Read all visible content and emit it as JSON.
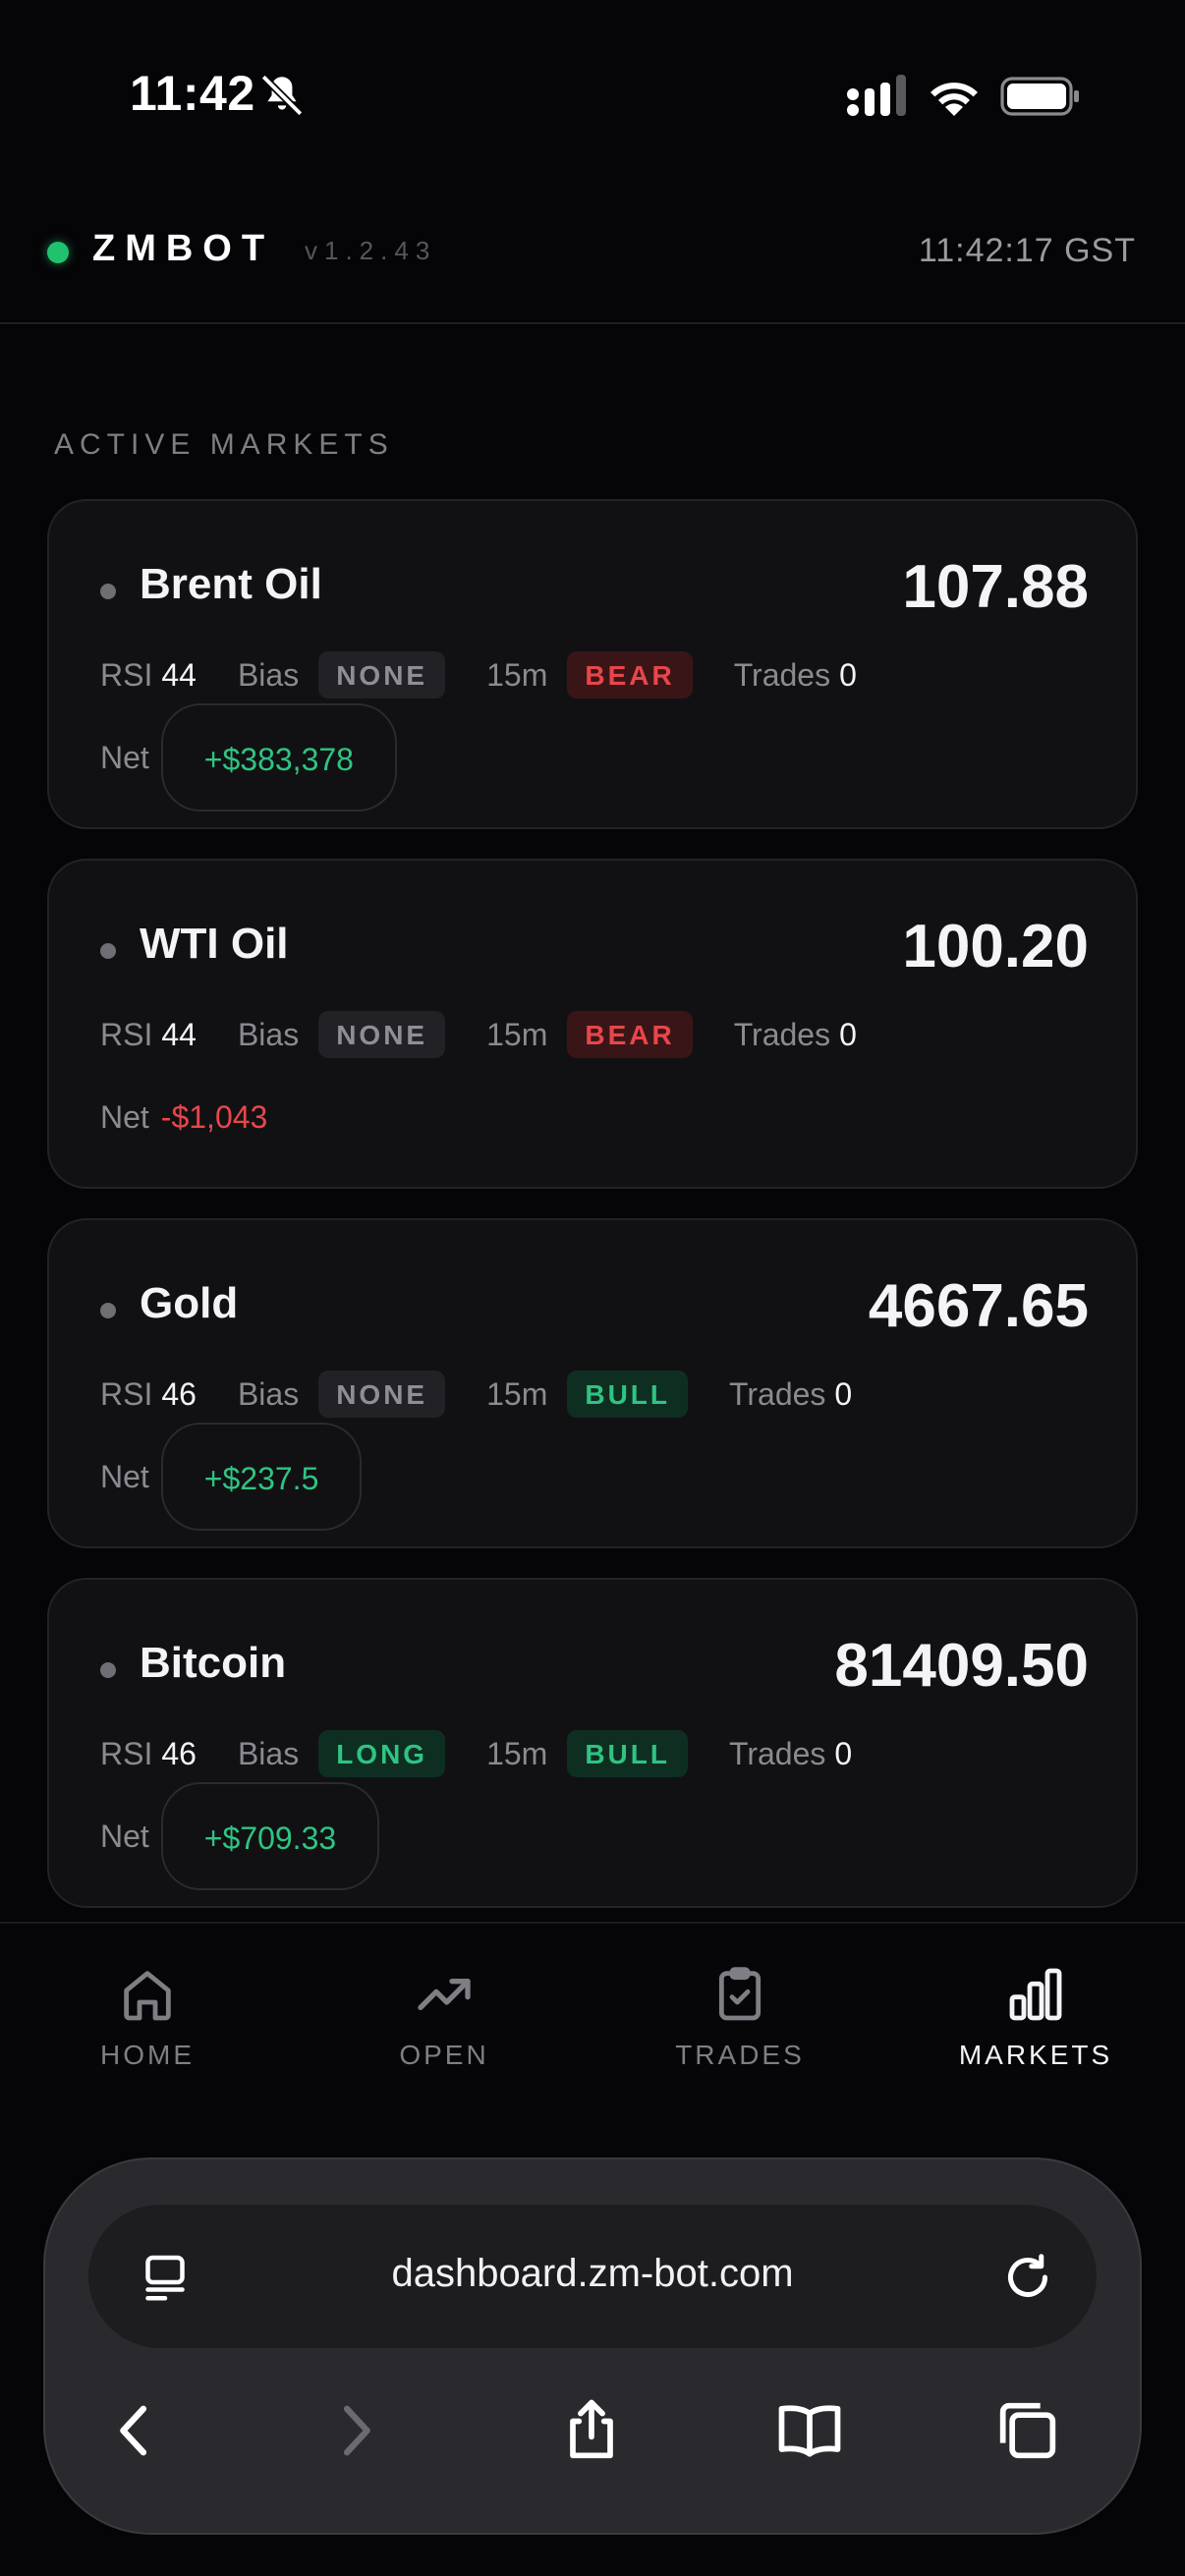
{
  "status_bar": {
    "time": "11:42"
  },
  "header": {
    "brand": "ZMBOT",
    "version": "v1.2.43",
    "time": "11:42:17 GST"
  },
  "section_title": "ACTIVE MARKETS",
  "markets": [
    {
      "name": "Brent Oil",
      "price": "107.88",
      "rsi_label": "RSI",
      "rsi": "44",
      "bias_label": "Bias",
      "bias": "NONE",
      "timeframe": "15m",
      "trend": "BEAR",
      "trades_label": "Trades",
      "trades": "0",
      "net_label": "Net",
      "net": "+$383,378"
    },
    {
      "name": "WTI Oil",
      "price": "100.20",
      "rsi_label": "RSI",
      "rsi": "44",
      "bias_label": "Bias",
      "bias": "NONE",
      "timeframe": "15m",
      "trend": "BEAR",
      "trades_label": "Trades",
      "trades": "0",
      "net_label": "Net",
      "net": "-$1,043"
    },
    {
      "name": "Gold",
      "price": "4667.65",
      "rsi_label": "RSI",
      "rsi": "46",
      "bias_label": "Bias",
      "bias": "NONE",
      "timeframe": "15m",
      "trend": "BULL",
      "trades_label": "Trades",
      "trades": "0",
      "net_label": "Net",
      "net": "+$237.5"
    },
    {
      "name": "Bitcoin",
      "price": "81409.50",
      "rsi_label": "RSI",
      "rsi": "46",
      "bias_label": "Bias",
      "bias": "LONG",
      "timeframe": "15m",
      "trend": "BULL",
      "trades_label": "Trades",
      "trades": "0",
      "net_label": "Net",
      "net": "+$709.33"
    }
  ],
  "tabs": [
    {
      "label": "HOME",
      "icon": "home-icon"
    },
    {
      "label": "OPEN",
      "icon": "trending-up-icon"
    },
    {
      "label": "TRADES",
      "icon": "clipboard-check-icon"
    },
    {
      "label": "MARKETS",
      "icon": "bar-chart-icon",
      "active": true
    }
  ],
  "browser": {
    "url": "dashboard.zm-bot.com"
  },
  "colors": {
    "background": "#050507",
    "card": "#111114",
    "positive": "#2fc482",
    "negative": "#e8464b",
    "live": "#20c26e"
  }
}
